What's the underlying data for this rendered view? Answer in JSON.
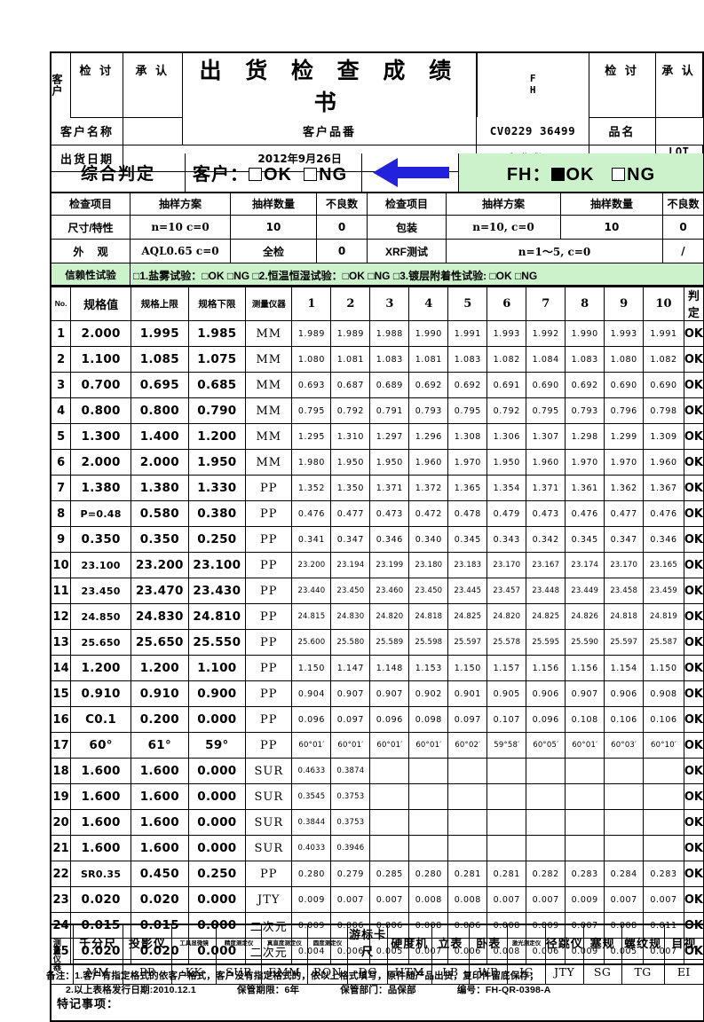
{
  "header": {
    "customer_vert": "客户",
    "review_label": "检 讨",
    "approve_label": "承 认",
    "title": "出 货 检 查 成 绩 书",
    "fh_label_line1": "F",
    "fh_label_line2": "H",
    "fh_review_label": "检 讨",
    "fh_approve_label": "承 认",
    "customer_name_label": "客户名称",
    "customer_name_value": "",
    "customer_partno_label": "客户品番",
    "customer_partno_value": "CV0229  36499",
    "product_name_label": "品名",
    "product_name_value": "",
    "ship_date_label": "出货日期",
    "ship_date_value": "2012年9月26日",
    "ship_qty_label": "出货数量",
    "ship_qty_value": "",
    "lot_no_label": "LOT No.",
    "lot_no_value": ""
  },
  "judgement": {
    "title": "综合判定",
    "customer_prefix": "客户：",
    "customer_ok": "OK",
    "customer_ng": "NG",
    "customer_ok_checked": false,
    "customer_ng_checked": false,
    "arrow_color": "#2222dd",
    "fh_prefix": "FH：",
    "fh_ok": "OK",
    "fh_ng": "NG",
    "fh_ok_checked": true,
    "fh_ng_checked": false,
    "green": "#ccf2cc"
  },
  "inspection": {
    "headers_left": [
      "检查项目",
      "抽样方案",
      "抽样数量",
      "不良数"
    ],
    "headers_right": [
      "检查项目",
      "抽样方案",
      "抽样数量",
      "不良数"
    ],
    "rows": [
      {
        "left_item": "尺寸/特性",
        "left_plan": "n=10  c=0",
        "left_qty": "10",
        "left_ng": "0",
        "right_item": "包装",
        "right_plan": "n=10, c=0",
        "right_qty": "10",
        "right_ng": "0"
      },
      {
        "left_item": "外  观",
        "left_plan": "AQL0.65  c=0",
        "left_qty": "全检",
        "left_ng": "0",
        "right_item": "XRF测试",
        "right_plan": "n=1～5, c=0",
        "right_qty": "/",
        "right_ng": "/"
      }
    ],
    "reliability_label": "信赖性试验",
    "reliability_text": "□1.盐雾试验：□OK  □NG   □2.恒温恒湿试验：□OK  □NG  □3.镀层附着性试验: □OK  □NG"
  },
  "table": {
    "headers": {
      "no": "No.",
      "spec": "规格值",
      "upper": "规格上限",
      "lower": "规格下限",
      "instrument": "测量仪器",
      "samples": [
        "1",
        "2",
        "3",
        "4",
        "5",
        "6",
        "7",
        "8",
        "9",
        "10"
      ],
      "judge": "判定"
    },
    "rows": [
      {
        "no": "1",
        "spec": "2.000",
        "upper": "1.995",
        "lower": "1.985",
        "inst": "MM",
        "vals": [
          "1.989",
          "1.989",
          "1.988",
          "1.990",
          "1.991",
          "1.993",
          "1.992",
          "1.990",
          "1.993",
          "1.991"
        ],
        "judge": "OK"
      },
      {
        "no": "2",
        "spec": "1.100",
        "upper": "1.085",
        "lower": "1.075",
        "inst": "MM",
        "vals": [
          "1.080",
          "1.081",
          "1.083",
          "1.081",
          "1.083",
          "1.082",
          "1.084",
          "1.083",
          "1.080",
          "1.082"
        ],
        "judge": "OK"
      },
      {
        "no": "3",
        "spec": "0.700",
        "upper": "0.695",
        "lower": "0.685",
        "inst": "MM",
        "vals": [
          "0.693",
          "0.687",
          "0.689",
          "0.692",
          "0.692",
          "0.691",
          "0.690",
          "0.692",
          "0.690",
          "0.690"
        ],
        "judge": "OK"
      },
      {
        "no": "4",
        "spec": "0.800",
        "upper": "0.800",
        "lower": "0.790",
        "inst": "MM",
        "vals": [
          "0.795",
          "0.792",
          "0.791",
          "0.793",
          "0.795",
          "0.792",
          "0.795",
          "0.793",
          "0.796",
          "0.798"
        ],
        "judge": "OK"
      },
      {
        "no": "5",
        "spec": "1.300",
        "upper": "1.400",
        "lower": "1.200",
        "inst": "MM",
        "vals": [
          "1.295",
          "1.310",
          "1.297",
          "1.296",
          "1.308",
          "1.306",
          "1.307",
          "1.298",
          "1.299",
          "1.309"
        ],
        "judge": "OK"
      },
      {
        "no": "6",
        "spec": "2.000",
        "upper": "2.000",
        "lower": "1.950",
        "inst": "MM",
        "vals": [
          "1.980",
          "1.950",
          "1.950",
          "1.960",
          "1.970",
          "1.950",
          "1.960",
          "1.970",
          "1.970",
          "1.960"
        ],
        "judge": "OK"
      },
      {
        "no": "7",
        "spec": "1.380",
        "upper": "1.380",
        "lower": "1.330",
        "inst": "PP",
        "vals": [
          "1.352",
          "1.350",
          "1.371",
          "1.372",
          "1.365",
          "1.354",
          "1.371",
          "1.361",
          "1.362",
          "1.367"
        ],
        "judge": "OK"
      },
      {
        "no": "8",
        "spec": "P=0.48",
        "upper": "0.580",
        "lower": "0.380",
        "inst": "PP",
        "vals": [
          "0.476",
          "0.477",
          "0.473",
          "0.472",
          "0.478",
          "0.479",
          "0.473",
          "0.476",
          "0.477",
          "0.476"
        ],
        "judge": "OK"
      },
      {
        "no": "9",
        "spec": "0.350",
        "upper": "0.350",
        "lower": "0.250",
        "inst": "PP",
        "vals": [
          "0.341",
          "0.347",
          "0.346",
          "0.340",
          "0.345",
          "0.343",
          "0.342",
          "0.345",
          "0.347",
          "0.346"
        ],
        "judge": "OK"
      },
      {
        "no": "10",
        "spec": "23.100",
        "upper": "23.200",
        "lower": "23.100",
        "inst": "PP",
        "vals": [
          "23.200",
          "23.194",
          "23.199",
          "23.180",
          "23.183",
          "23.170",
          "23.167",
          "23.174",
          "23.170",
          "23.165"
        ],
        "judge": "OK"
      },
      {
        "no": "11",
        "spec": "23.450",
        "upper": "23.470",
        "lower": "23.430",
        "inst": "PP",
        "vals": [
          "23.440",
          "23.450",
          "23.460",
          "23.450",
          "23.445",
          "23.457",
          "23.448",
          "23.449",
          "23.458",
          "23.459"
        ],
        "judge": "OK"
      },
      {
        "no": "12",
        "spec": "24.850",
        "upper": "24.830",
        "lower": "24.810",
        "inst": "PP",
        "vals": [
          "24.815",
          "24.830",
          "24.820",
          "24.818",
          "24.825",
          "24.820",
          "24.825",
          "24.826",
          "24.818",
          "24.819"
        ],
        "judge": "OK"
      },
      {
        "no": "13",
        "spec": "25.650",
        "upper": "25.650",
        "lower": "25.550",
        "inst": "PP",
        "vals": [
          "25.600",
          "25.580",
          "25.589",
          "25.598",
          "25.597",
          "25.578",
          "25.595",
          "25.590",
          "25.597",
          "25.587"
        ],
        "judge": "OK"
      },
      {
        "no": "14",
        "spec": "1.200",
        "upper": "1.200",
        "lower": "1.100",
        "inst": "PP",
        "vals": [
          "1.150",
          "1.147",
          "1.148",
          "1.153",
          "1.150",
          "1.157",
          "1.156",
          "1.156",
          "1.154",
          "1.150"
        ],
        "judge": "OK"
      },
      {
        "no": "15",
        "spec": "0.910",
        "upper": "0.910",
        "lower": "0.900",
        "inst": "PP",
        "vals": [
          "0.904",
          "0.907",
          "0.907",
          "0.902",
          "0.901",
          "0.905",
          "0.906",
          "0.907",
          "0.906",
          "0.908"
        ],
        "judge": "OK"
      },
      {
        "no": "16",
        "spec": "C0.1",
        "upper": "0.200",
        "lower": "0.000",
        "inst": "PP",
        "vals": [
          "0.096",
          "0.097",
          "0.096",
          "0.098",
          "0.097",
          "0.107",
          "0.096",
          "0.108",
          "0.106",
          "0.106"
        ],
        "judge": "OK"
      },
      {
        "no": "17",
        "spec": "60°",
        "upper": "61°",
        "lower": "59°",
        "inst": "PP",
        "vals": [
          "60°01′",
          "60°01′",
          "60°01′",
          "60°01′",
          "60°02′",
          "59°58′",
          "60°05′",
          "60°01′",
          "60°03′",
          "60°10′"
        ],
        "judge": "OK"
      },
      {
        "no": "18",
        "spec": "1.600",
        "upper": "1.600",
        "lower": "0.000",
        "inst": "SUR",
        "vals": [
          "0.4633",
          "0.3874",
          "",
          "",
          "",
          "",
          "",
          "",
          "",
          ""
        ],
        "judge": "OK"
      },
      {
        "no": "19",
        "spec": "1.600",
        "upper": "1.600",
        "lower": "0.000",
        "inst": "SUR",
        "vals": [
          "0.3545",
          "0.3753",
          "",
          "",
          "",
          "",
          "",
          "",
          "",
          ""
        ],
        "judge": "OK"
      },
      {
        "no": "20",
        "spec": "1.600",
        "upper": "1.600",
        "lower": "0.000",
        "inst": "SUR",
        "vals": [
          "0.3844",
          "0.3753",
          "",
          "",
          "",
          "",
          "",
          "",
          "",
          ""
        ],
        "judge": "OK"
      },
      {
        "no": "21",
        "spec": "1.600",
        "upper": "1.600",
        "lower": "0.000",
        "inst": "SUR",
        "vals": [
          "0.4033",
          "0.3946",
          "",
          "",
          "",
          "",
          "",
          "",
          "",
          ""
        ],
        "judge": "OK"
      },
      {
        "no": "22",
        "spec": "SR0.35",
        "upper": "0.450",
        "lower": "0.250",
        "inst": "PP",
        "vals": [
          "0.280",
          "0.279",
          "0.285",
          "0.280",
          "0.281",
          "0.281",
          "0.282",
          "0.283",
          "0.284",
          "0.283"
        ],
        "judge": "OK"
      },
      {
        "no": "23",
        "spec": "0.020",
        "upper": "0.020",
        "lower": "0.000",
        "inst": "JTY",
        "vals": [
          "0.009",
          "0.007",
          "0.007",
          "0.008",
          "0.008",
          "0.007",
          "0.007",
          "0.009",
          "0.007",
          "0.007"
        ],
        "judge": "OK"
      },
      {
        "no": "24",
        "spec": "0.015",
        "upper": "0.015",
        "lower": "0.000",
        "inst": "二次元",
        "vals": [
          "0.009",
          "0.006",
          "0.006",
          "0.008",
          "0.006",
          "0.008",
          "0.009",
          "0.007",
          "0.008",
          "0.011"
        ],
        "judge": "OK"
      },
      {
        "no": "25",
        "spec": "0.020",
        "upper": "0.020",
        "lower": "0.000",
        "inst": "二次元",
        "vals": [
          "0.004",
          "0.006",
          "0.005",
          "0.007",
          "0.006",
          "0.008",
          "0.006",
          "0.009",
          "0.005",
          "0.007"
        ],
        "judge": "OK"
      }
    ]
  },
  "instruments": {
    "vertical_label": "测量仪器",
    "names": [
      "千分尺",
      "投影仪",
      "工具显微镜",
      "精度测定仪",
      "真直度测定仪",
      "圆度测定仪",
      "游标卡尺",
      "硬度机",
      "立表",
      "卧表",
      "激光测定仪",
      "径跳仪",
      "塞规",
      "螺纹规",
      "目视"
    ],
    "codes": [
      "MM",
      "PP",
      "KK",
      "SUR",
      "EMM",
      "RON",
      "DG",
      "HTM",
      "LB",
      "WB",
      "JG",
      "JTY",
      "SG",
      "TG",
      "EI"
    ],
    "special_note_label": "特记事项：",
    "special_note_value": ""
  },
  "remarks": {
    "line1": "备注：1.客户有指定格式的依客户格式，客户没有指定格式的，依以上格式填写，原件随产品出货，复印件留底保存；",
    "line2_a": "2.以上表格发行日期:2010.12.1",
    "line2_b": "保管期限：6年",
    "line2_c": "保管部门：品保部",
    "line2_d": "编号：FH-QR-0398-A"
  }
}
